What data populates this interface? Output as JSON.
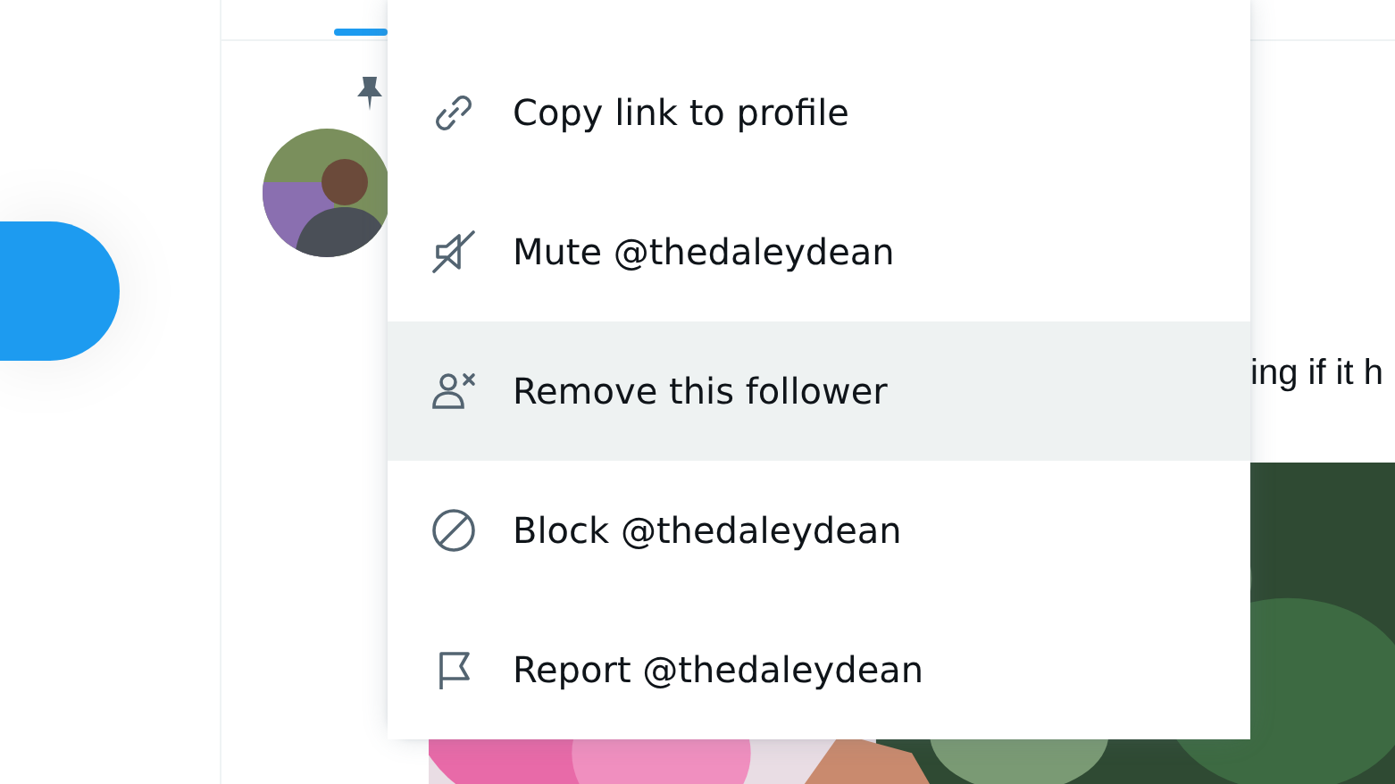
{
  "tweet": {
    "pinned": true,
    "text": "ing if it h"
  },
  "menu": {
    "items": [
      {
        "kind": "link",
        "label": "Copy link to profile",
        "highlighted": false
      },
      {
        "kind": "mute",
        "label": "Mute @thedaleydean",
        "highlighted": false
      },
      {
        "kind": "remove",
        "label": "Remove this follower",
        "highlighted": true
      },
      {
        "kind": "block",
        "label": "Block @thedaleydean",
        "highlighted": false
      },
      {
        "kind": "report",
        "label": "Report @thedaleydean",
        "highlighted": false
      }
    ]
  }
}
